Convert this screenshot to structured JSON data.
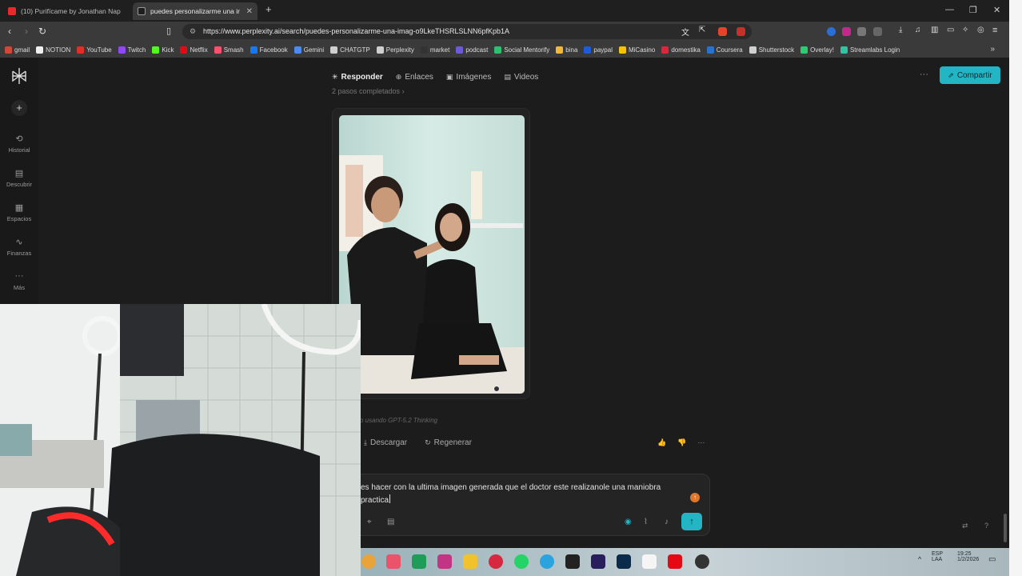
{
  "browser": {
    "tabs": [
      {
        "label": "(10) Purifícame by Jonathan Nap",
        "active": false,
        "favicon_color": "#e32b2b"
      },
      {
        "label": "puedes personalizarme una imag",
        "active": true,
        "favicon_color": "#1e1e1e"
      }
    ],
    "new_tab_icon": "plus-icon",
    "url": "https://www.perplexity.ai/search/puedes-personalizarme-una-imag-o9LkeTHSRLSLNN6pfKpb1A",
    "bookmarks": [
      {
        "label": "gmail",
        "color": "#d44638"
      },
      {
        "label": "NOTION",
        "color": "#f0f0f0"
      },
      {
        "label": "YouTube",
        "color": "#e52d27"
      },
      {
        "label": "Twitch",
        "color": "#9146ff"
      },
      {
        "label": "Kick",
        "color": "#53fc18"
      },
      {
        "label": "Netflix",
        "color": "#e50914"
      },
      {
        "label": "Smash",
        "color": "#ff4f6e"
      },
      {
        "label": "Facebook",
        "color": "#1877f2"
      },
      {
        "label": "Gemini",
        "color": "#4c8bf5"
      },
      {
        "label": "CHATGTP",
        "color": "#cfcfcf"
      },
      {
        "label": "Perplexity",
        "color": "#cfcfcf"
      },
      {
        "label": "market",
        "color": "#333333"
      },
      {
        "label": "podcast",
        "color": "#6b5bd6"
      },
      {
        "label": "Social Mentorify",
        "color": "#2fbf71"
      },
      {
        "label": "bina",
        "color": "#f3ba2f"
      },
      {
        "label": "paypal",
        "color": "#1e5bd8"
      },
      {
        "label": "MiCasino",
        "color": "#f5c400"
      },
      {
        "label": "domestika",
        "color": "#e0243b"
      },
      {
        "label": "Coursera",
        "color": "#2a73cc"
      },
      {
        "label": "Shutterstock",
        "color": "#d0d0d0"
      },
      {
        "label": "Overlay!",
        "color": "#2ecc71"
      },
      {
        "label": "Streamlabs Login",
        "color": "#31c3a2"
      }
    ]
  },
  "sidebar": {
    "items": [
      {
        "label": "Historial",
        "icon": "history-icon",
        "glyph": "⟲"
      },
      {
        "label": "Descubrir",
        "icon": "discover-icon",
        "glyph": "▤"
      },
      {
        "label": "Espacios",
        "icon": "spaces-icon",
        "glyph": "▦"
      },
      {
        "label": "Finanzas",
        "icon": "finance-icon",
        "glyph": "∿"
      },
      {
        "label": "Más",
        "icon": "more-icon",
        "glyph": "···"
      }
    ]
  },
  "topnav": {
    "tabs": [
      {
        "label": "Responder",
        "icon": "perplexity-answer-icon",
        "glyph": "✳",
        "active": true
      },
      {
        "label": "Enlaces",
        "icon": "globe-icon",
        "glyph": "⊕",
        "active": false
      },
      {
        "label": "Imágenes",
        "icon": "image-icon",
        "glyph": "▣",
        "active": false
      },
      {
        "label": "Videos",
        "icon": "video-icon",
        "glyph": "▤",
        "active": false
      }
    ],
    "more": "···",
    "share_label": "Compartir"
  },
  "answer": {
    "steps_label": "2 pasos completados",
    "model_label": "o usando GPT-5.2 Thinking",
    "actions": [
      {
        "label": "Descargar",
        "icon": "download-icon",
        "glyph": "⤓"
      },
      {
        "label": "Regenerar",
        "icon": "regenerate-icon",
        "glyph": "↻"
      }
    ],
    "feedback": [
      "👍",
      "👎",
      "···"
    ]
  },
  "composer": {
    "text_line1": "es hacer con la ultima imagen generada que el doctor este realizanole una maniobra",
    "text_line2": "practica",
    "send_label": "↑",
    "accent": "#22b5c4"
  }
}
